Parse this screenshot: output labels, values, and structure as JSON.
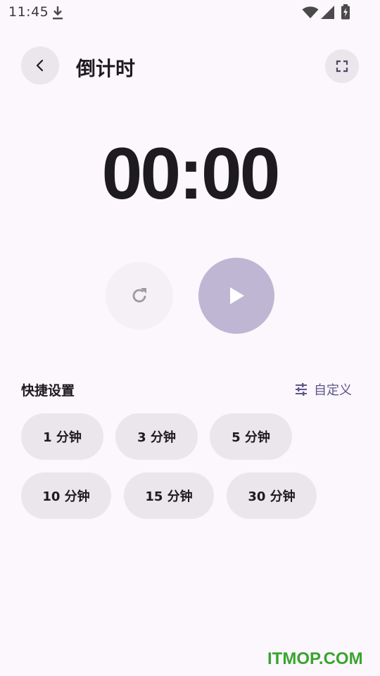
{
  "status_bar": {
    "time": "11:45",
    "icons": [
      "download-icon",
      "wifi-icon",
      "signal-icon",
      "battery-icon"
    ]
  },
  "header": {
    "back_icon": "chevron-left-icon",
    "title": "倒计时",
    "fullscreen_icon": "fullscreen-icon"
  },
  "timer": {
    "display": "00:00"
  },
  "controls": {
    "reset_icon": "refresh-icon",
    "play_icon": "play-icon"
  },
  "quick_settings": {
    "title": "快捷设置",
    "custom_label": "自定义",
    "custom_icon": "tune-icon",
    "presets": [
      {
        "label": "1 分钟"
      },
      {
        "label": "3 分钟"
      },
      {
        "label": "5 分钟"
      },
      {
        "label": "10 分钟"
      },
      {
        "label": "15 分钟"
      },
      {
        "label": "30 分钟"
      }
    ]
  },
  "watermark": "ITMOP.COM",
  "colors": {
    "background": "#fcf6fd",
    "play_button": "#beb6d2",
    "chip": "#ebe6ec",
    "accent": "#5b5685",
    "watermark": "#38a52e"
  }
}
